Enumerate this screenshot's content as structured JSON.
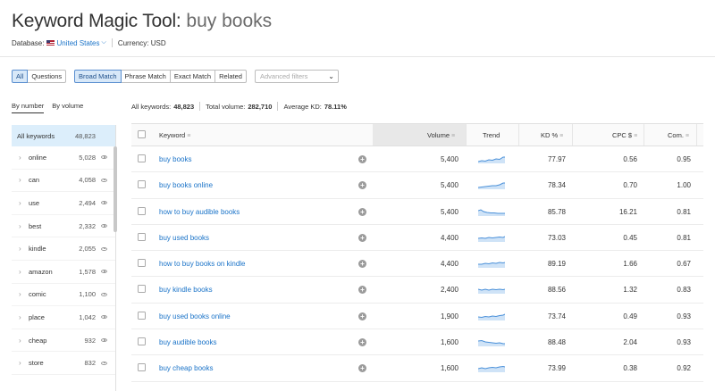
{
  "header": {
    "title_tool": "Keyword Magic Tool:",
    "title_query": "buy books",
    "database_label": "Database:",
    "database_value": "United States",
    "currency": "Currency: USD"
  },
  "match_tabs": [
    {
      "label": "All",
      "selected": true
    },
    {
      "label": "Questions",
      "selected": false
    }
  ],
  "match_types": [
    {
      "label": "Broad Match",
      "selected": true
    },
    {
      "label": "Phrase Match",
      "selected": false
    },
    {
      "label": "Exact Match",
      "selected": false
    },
    {
      "label": "Related",
      "selected": false
    }
  ],
  "advanced_filters": "Advanced filters",
  "sort_tabs": {
    "by_number": "By number",
    "by_volume": "By volume"
  },
  "stats": {
    "all_keywords_label": "All keywords:",
    "all_keywords_value": "48,823",
    "total_volume_label": "Total volume:",
    "total_volume_value": "282,710",
    "avg_kd_label": "Average KD:",
    "avg_kd_value": "78.11%"
  },
  "sidebar": {
    "all_label": "All keywords",
    "all_count": "48,823",
    "groups": [
      {
        "label": "online",
        "count": "5,028"
      },
      {
        "label": "can",
        "count": "4,058"
      },
      {
        "label": "use",
        "count": "2,494"
      },
      {
        "label": "best",
        "count": "2,332"
      },
      {
        "label": "kindle",
        "count": "2,055"
      },
      {
        "label": "amazon",
        "count": "1,578"
      },
      {
        "label": "comic",
        "count": "1,100"
      },
      {
        "label": "place",
        "count": "1,042"
      },
      {
        "label": "cheap",
        "count": "932"
      },
      {
        "label": "store",
        "count": "832"
      }
    ]
  },
  "table": {
    "columns": {
      "keyword": "Keyword",
      "volume": "Volume",
      "trend": "Trend",
      "kd": "KD %",
      "cpc": "CPC $",
      "com": "Com."
    },
    "rows": [
      {
        "keyword": "buy books",
        "volume": "5,400",
        "kd": "77.97",
        "cpc": "0.56",
        "com": "0.95"
      },
      {
        "keyword": "buy books online",
        "volume": "5,400",
        "kd": "78.34",
        "cpc": "0.70",
        "com": "1.00"
      },
      {
        "keyword": "how to buy audible books",
        "volume": "5,400",
        "kd": "85.78",
        "cpc": "16.21",
        "com": "0.81"
      },
      {
        "keyword": "buy used books",
        "volume": "4,400",
        "kd": "73.03",
        "cpc": "0.45",
        "com": "0.81"
      },
      {
        "keyword": "how to buy books on kindle",
        "volume": "4,400",
        "kd": "89.19",
        "cpc": "1.66",
        "com": "0.67"
      },
      {
        "keyword": "buy kindle books",
        "volume": "2,400",
        "kd": "88.56",
        "cpc": "1.32",
        "com": "0.83"
      },
      {
        "keyword": "buy used books online",
        "volume": "1,900",
        "kd": "73.74",
        "cpc": "0.49",
        "com": "0.93"
      },
      {
        "keyword": "buy audible books",
        "volume": "1,600",
        "kd": "88.48",
        "cpc": "2.04",
        "com": "0.93"
      },
      {
        "keyword": "buy cheap books",
        "volume": "1,600",
        "kd": "73.99",
        "cpc": "0.38",
        "com": "0.92"
      }
    ]
  },
  "colors": {
    "link": "#1a73c8",
    "trend": "#4a90d9",
    "selected_bg": "#d8e8f8"
  }
}
